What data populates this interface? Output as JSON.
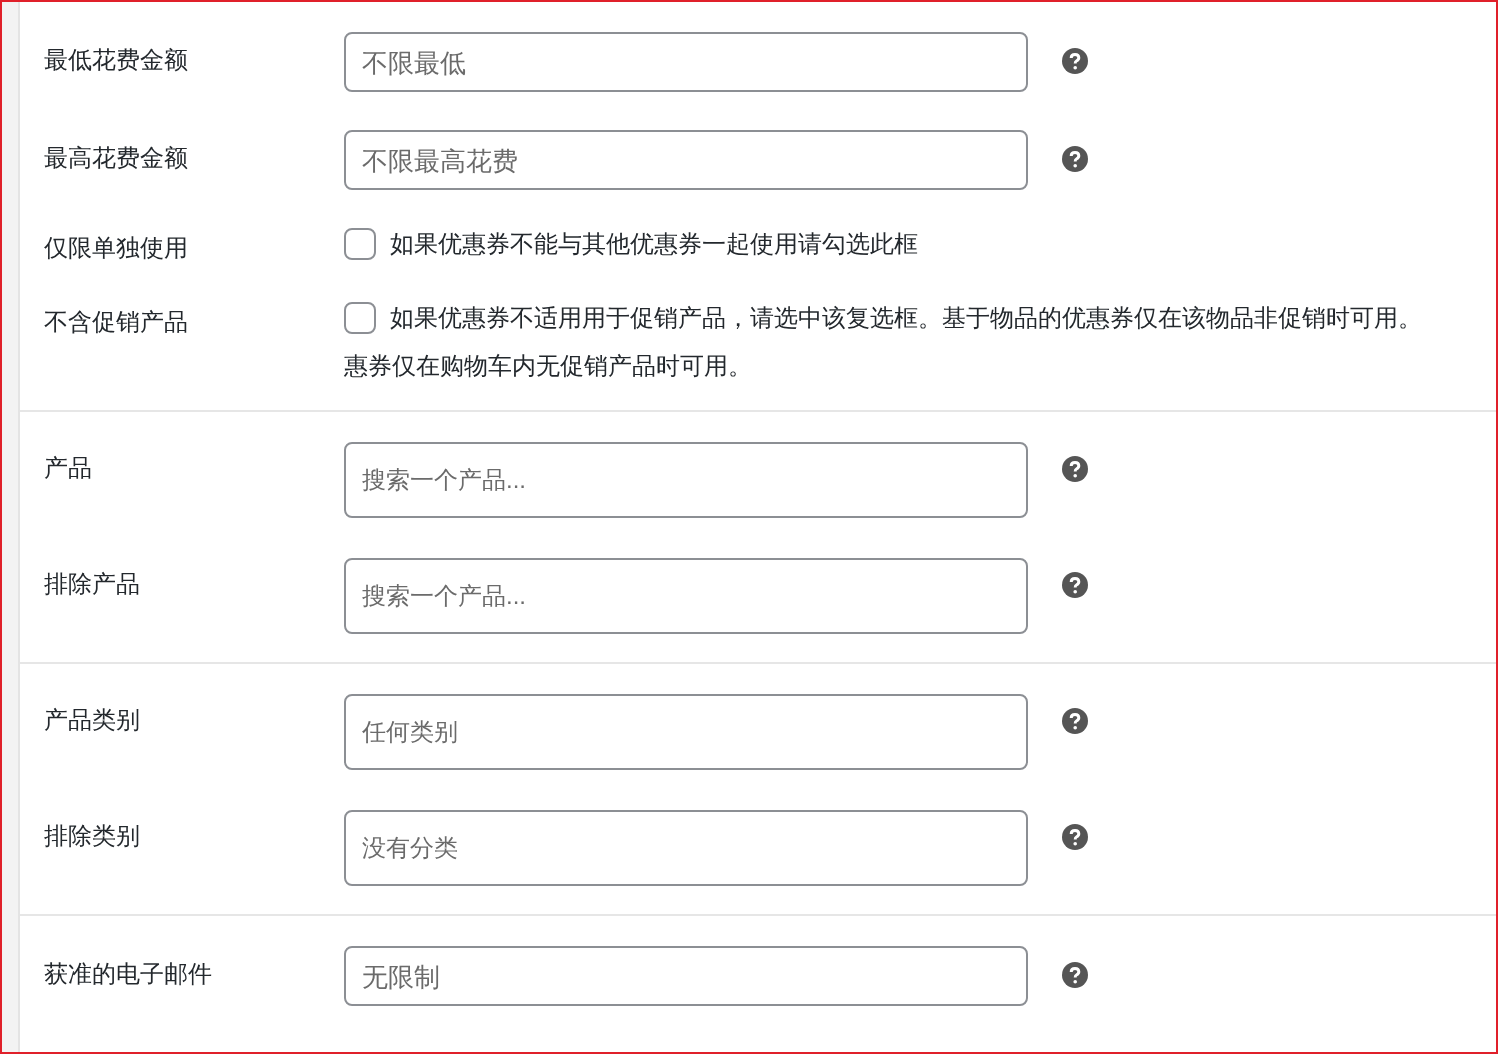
{
  "sections": [
    {
      "rows": [
        {
          "kind": "text",
          "label": "最低花费金额",
          "placeholder": "不限最低"
        },
        {
          "kind": "text",
          "label": "最高花费金额",
          "placeholder": "不限最高花费"
        },
        {
          "kind": "checkbox",
          "label": "仅限单独使用",
          "checked": false,
          "description_lines": [
            "如果优惠券不能与其他优惠券一起使用请勾选此框"
          ]
        },
        {
          "kind": "checkbox",
          "label": "不含促销产品",
          "checked": false,
          "description_lines": [
            "如果优惠券不适用用于促销产品，请选中该复选框。基于物品的优惠券仅在该物品非促销时可用。",
            "惠券仅在购物车内无促销产品时可用。"
          ]
        }
      ]
    },
    {
      "rows": [
        {
          "kind": "search",
          "label": "产品",
          "placeholder": "搜索一个产品..."
        },
        {
          "kind": "search",
          "label": "排除产品",
          "placeholder": "搜索一个产品..."
        }
      ]
    },
    {
      "rows": [
        {
          "kind": "search",
          "label": "产品类别",
          "placeholder": "任何类别"
        },
        {
          "kind": "search",
          "label": "排除类别",
          "placeholder": "没有分类"
        }
      ]
    },
    {
      "rows": [
        {
          "kind": "text",
          "label": "获准的电子邮件",
          "placeholder": "无限制"
        }
      ]
    }
  ]
}
